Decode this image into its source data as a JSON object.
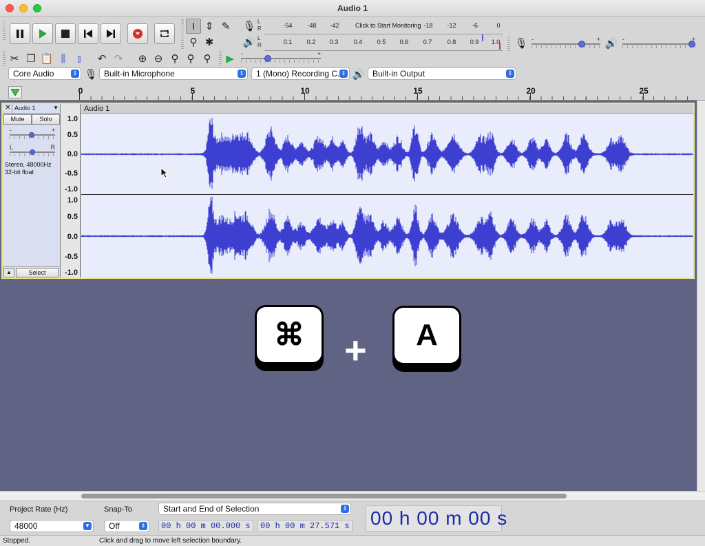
{
  "window": {
    "title": "Audio 1"
  },
  "meters": {
    "record_ticks": [
      "-54",
      "-48",
      "-42",
      "-18",
      "-12",
      "-6",
      "0"
    ],
    "record_message": "Click to Start Monitoring",
    "play_ticks": [
      "0.1",
      "0.2",
      "0.3",
      "0.4",
      "0.5",
      "0.6",
      "0.7",
      "0.8",
      "0.9",
      "1.0"
    ],
    "channels": [
      "L",
      "R"
    ]
  },
  "mixer": {
    "minus": "-",
    "plus": "+"
  },
  "devices": {
    "host": "Core Audio",
    "input": "Built-in Microphone",
    "channels": "1 (Mono) Recording C...",
    "output": "Built-in Output"
  },
  "ruler": {
    "labels": [
      "0",
      "5",
      "10",
      "15",
      "20",
      "25"
    ]
  },
  "track": {
    "close": "✕",
    "name": "Audio 1",
    "mute": "Mute",
    "solo": "Solo",
    "gain_minus": "-",
    "gain_plus": "+",
    "pan_left": "L",
    "pan_right": "R",
    "info_line1": "Stereo, 48000Hz",
    "info_line2": "32-bit float",
    "select": "Select",
    "clip_name": "Audio 1",
    "y_labels": [
      "1.0",
      "0.5",
      "0.0",
      "-0.5",
      "-1.0"
    ]
  },
  "overlay": {
    "key1": "⌘",
    "plus": "+",
    "key2": "A"
  },
  "selection": {
    "project_rate_label": "Project Rate (Hz)",
    "project_rate": "48000",
    "snap_label": "Snap-To",
    "snap_value": "Off",
    "mode": "Start and End of Selection",
    "start_time": "00 h 00 m 00.000 s",
    "end_time": "00 h 00 m 27.571 s",
    "audio_position": "00 h 00 m 00 s"
  },
  "status": {
    "state": "Stopped.",
    "hint": "Click and drag to move left selection boundary."
  },
  "colors": {
    "waveform": "#3d3fd0",
    "track_bg": "#e9edfb",
    "workspace": "#606384",
    "selected_border": "#e8e58a"
  }
}
